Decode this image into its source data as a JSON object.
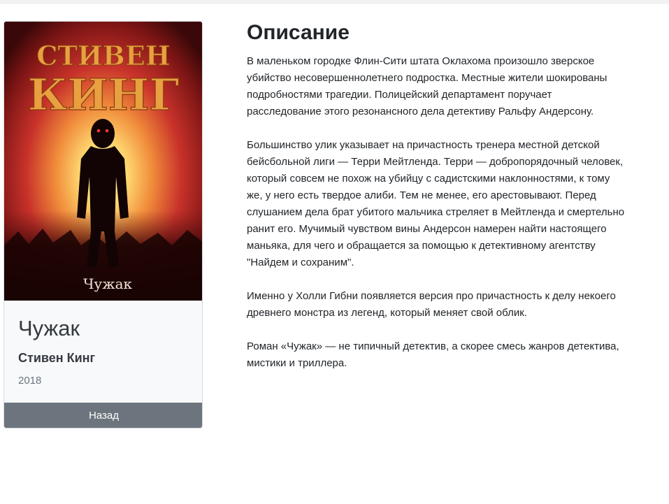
{
  "book": {
    "cover_author_text": "СТИВЕН КИНГ",
    "cover_title_text": "Чужак",
    "title": "Чужак",
    "author": "Стивен Кинг",
    "year": "2018"
  },
  "actions": {
    "back_label": "Назад"
  },
  "description": {
    "heading": "Описание",
    "paragraphs": [
      "В маленьком городке Флин-Сити штата Оклахома произошло зверское убийство несовершеннолетнего подростка. Местные жители шокированы подробностями трагедии. Полицейский департамент поручает расследование этого резонансного дела детективу Ральфу Андерсону.",
      "Большинство улик указывает на причастность тренера местной детской бейсбольной лиги — Терри Мейтленда. Терри — добропорядочный человек, который совсем не похож на убийцу с садистскими наклонностями, к тому же, у него есть твердое алиби. Тем не менее, его арестовывают. Перед слушанием дела брат убитого мальчика стреляет в Мейтленда и смертельно ранит его. Мучимый чувством вины Андерсон намерен найти настоящего маньяка, для чего и обращается за помощью к детективному агентству \"Найдем и сохраним\".",
      "Именно у Холли Гибни появляется версия про причастность к делу некоего древнего монстра из легенд, который меняет свой облик.",
      "Роман «Чужак» — не типичный детектив, а скорее смесь жанров детектива, мистики и триллера."
    ]
  }
}
